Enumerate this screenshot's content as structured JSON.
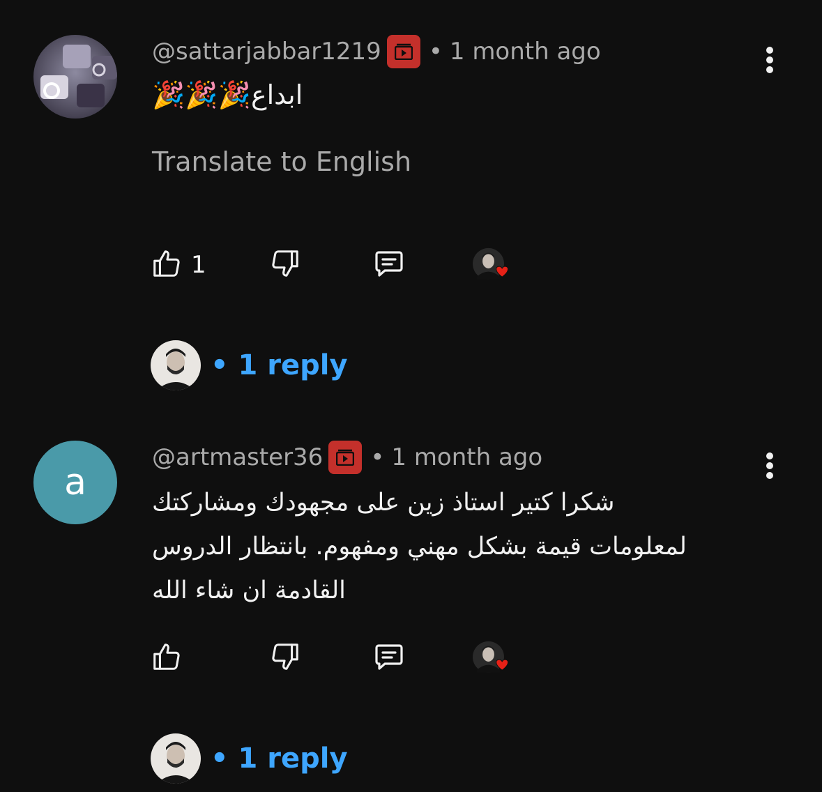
{
  "comments": [
    {
      "handle": "@sattarjabbar1219",
      "separator": "•",
      "time": "1 month ago",
      "text": "ابداع🎉🎉🎉",
      "translate_label": "Translate to English",
      "like_count": "1",
      "replies_label": "• 1 reply",
      "avatar_icon": "photo-avatar",
      "badge_icon": "member-badge-icon"
    },
    {
      "avatar_letter": "a",
      "handle": "@artmaster36",
      "separator": "•",
      "time": "1 month ago",
      "text": "شكرا كتير استاذ زين على مجهودك ومشاركتك لمعلومات قيمة بشكل مهني ومفهوم. بانتظار الدروس القادمة ان شاء الله",
      "like_count": "",
      "replies_label": "• 1 reply",
      "badge_icon": "member-badge-icon"
    }
  ],
  "colors": {
    "background": "#0f0f0f",
    "text_primary": "#f1f1f1",
    "text_secondary": "#aaaaaa",
    "link": "#3ea6ff",
    "badge": "#c4302b",
    "heart": "#e62117",
    "letter_avatar": "#4a9aa9"
  }
}
